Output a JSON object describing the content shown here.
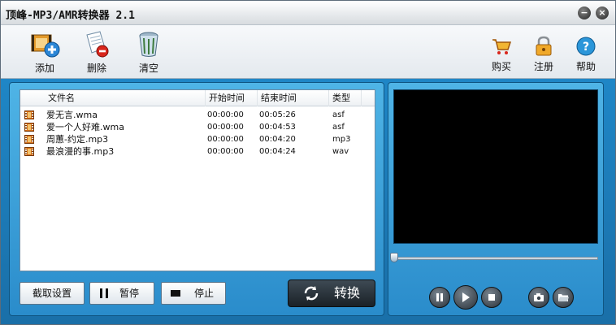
{
  "window": {
    "title": "顶峰-MP3/AMR转换器 2.1",
    "min_label": "−",
    "close_label": "×"
  },
  "toolbar": {
    "add_label": "添加",
    "delete_label": "删除",
    "clear_label": "清空",
    "buy_label": "购买",
    "register_label": "注册",
    "help_label": "帮助"
  },
  "list": {
    "headers": [
      "文件名",
      "开始时间",
      "结束时间",
      "类型"
    ],
    "rows": [
      {
        "name": "爱无言.wma",
        "start": "00:00:00",
        "end": "00:05:26",
        "type": "asf"
      },
      {
        "name": "爱一个人好难.wma",
        "start": "00:00:00",
        "end": "00:04:53",
        "type": "asf"
      },
      {
        "name": "周蕙-约定.mp3",
        "start": "00:00:00",
        "end": "00:04:20",
        "type": "mp3"
      },
      {
        "name": "最浪漫的事.mp3",
        "start": "00:00:00",
        "end": "00:04:24",
        "type": "wav"
      }
    ]
  },
  "buttons": {
    "crop_settings_label": "截取设置",
    "pause_label": "暂停",
    "stop_label": "停止",
    "convert_label": "转换"
  },
  "player": {
    "seek_position": 0
  },
  "colors": {
    "accent": "#2a8ccb",
    "panel_dark": "#1a6fa8",
    "video_bg": "#000000"
  }
}
